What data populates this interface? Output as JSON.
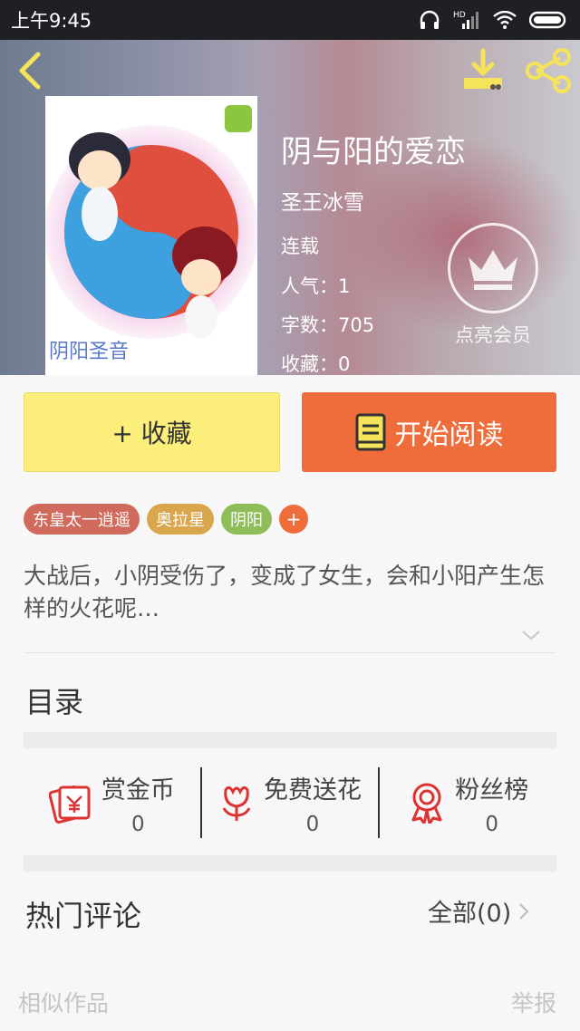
{
  "status_bar": {
    "time": "上午9:45",
    "network": "HD"
  },
  "book": {
    "title": "阴与阳的爱恋",
    "author": "圣王冰雪",
    "status": "连载",
    "popularity": "人气：1",
    "word_count": "字数：705",
    "favorites": "收藏：0",
    "cover_caption": "阴阳圣音"
  },
  "vip": {
    "label": "点亮会员"
  },
  "actions": {
    "collect_label": "+ 收藏",
    "read_label": "开始阅读"
  },
  "tags": [
    {
      "label": "东皇太一逍遥",
      "color": "#d06a5c"
    },
    {
      "label": "奥拉星",
      "color": "#d9a64e"
    },
    {
      "label": "阴阳",
      "color": "#8fbd5a"
    }
  ],
  "tag_add": "+",
  "summary": "大战后，小阴受伤了，变成了女生，会和小阳产生怎样的火花呢…",
  "toc": {
    "title": "目录"
  },
  "stats": [
    {
      "label": "赏金币",
      "value": "0",
      "icon": "reward-coin-icon"
    },
    {
      "label": "免费送花",
      "value": "0",
      "icon": "flower-icon"
    },
    {
      "label": "粉丝榜",
      "value": "0",
      "icon": "medal-icon"
    }
  ],
  "comments": {
    "title": "热门评论",
    "all_label": "全部(0)"
  },
  "footer": {
    "similar": "相似作品",
    "report": "举报"
  },
  "colors": {
    "accent": "#ef6d3a",
    "collect": "#fbee7a",
    "icon_yellow": "#f5e35a"
  }
}
